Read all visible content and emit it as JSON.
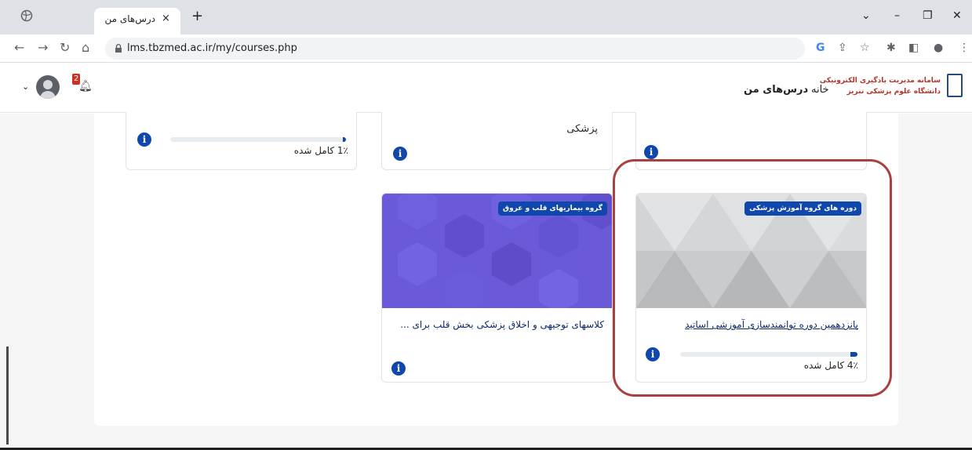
{
  "browser": {
    "tab_title": "درس‌های من",
    "tab_close": "×",
    "new_tab": "+",
    "url": "lms.tbzmed.ac.ir/my/courses.php"
  },
  "site": {
    "logo_line1": "سامانه مدیریت یادگیری الکترونیکی",
    "logo_line2": "دانشگاه علوم پزشکی تبریز",
    "nav_home": "خانه",
    "nav_my_courses": "درس‌های من",
    "notification_count": "2"
  },
  "top_row": {
    "card_left": {
      "progress_text": "1٪ کامل شده",
      "progress_percent": 1
    },
    "card_middle": {
      "title_fragment": "پزشکی"
    }
  },
  "courses": [
    {
      "category": "دوره های گروه آموزش پزشکی",
      "title": "پانزدهمین دوره توانمندسازی آموزشی اساتید",
      "progress_text": "4٪ کامل شده",
      "progress_percent": 4
    },
    {
      "category": "گروه بیماریهای قلب و عروق",
      "title": "کلاسهای توجیهی و اخلاق پزشکی بخش قلب برای ..."
    }
  ],
  "colors": {
    "brand_blue": "#0f47ad",
    "highlight_ring": "#a8413f",
    "purple_image": "#6a5ad8"
  }
}
